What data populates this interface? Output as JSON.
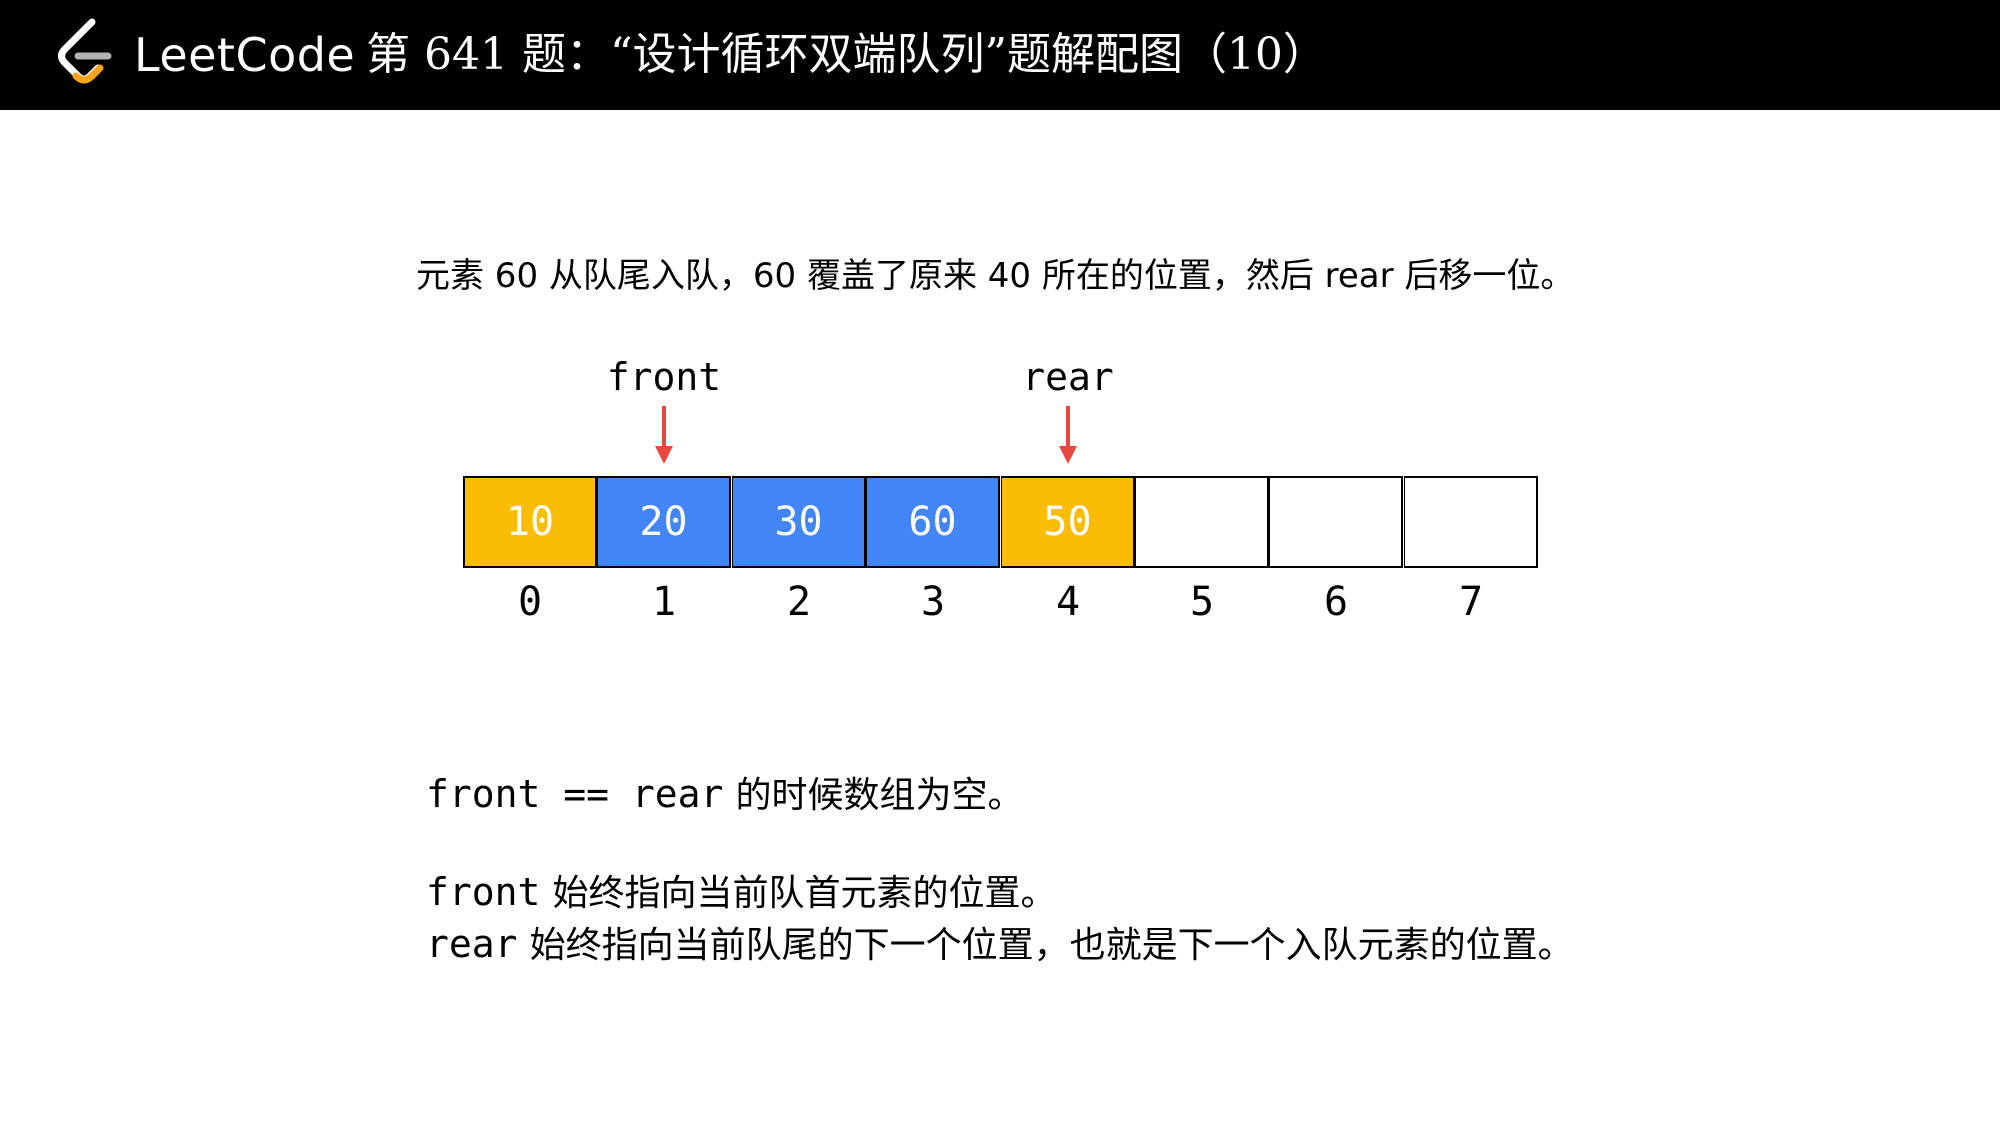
{
  "header": {
    "brand": "LeetCode",
    "title": "第 641 题：“设计循环双端队列”题解配图（10）"
  },
  "description": "元素 60 从队尾入队，60 覆盖了原来 40 所在的位置，然后 rear 后移一位。",
  "pointers": {
    "front": {
      "label": "front",
      "index": 1,
      "arrow_color": "#e9473f"
    },
    "rear": {
      "label": "rear",
      "index": 4,
      "arrow_color": "#e9473f"
    }
  },
  "queue": {
    "cells": [
      {
        "index": "0",
        "value": "10",
        "fill": "#fbbc05"
      },
      {
        "index": "1",
        "value": "20",
        "fill": "#4285f4"
      },
      {
        "index": "2",
        "value": "30",
        "fill": "#4285f4"
      },
      {
        "index": "3",
        "value": "60",
        "fill": "#4285f4"
      },
      {
        "index": "4",
        "value": "50",
        "fill": "#fbbc05"
      },
      {
        "index": "5",
        "value": "",
        "fill": "#ffffff"
      },
      {
        "index": "6",
        "value": "",
        "fill": "#ffffff"
      },
      {
        "index": "7",
        "value": "",
        "fill": "#ffffff"
      }
    ]
  },
  "notes": {
    "empty_rule": {
      "code": "front == rear",
      "text": "的时候数组为空。"
    },
    "front_rule": {
      "code": "front",
      "text": "始终指向当前队首元素的位置。"
    },
    "rear_rule": {
      "code": "rear",
      "text": "始终指向当前队尾的下一个位置，也就是下一个入队元素的位置。"
    }
  },
  "colors": {
    "header_bg": "#000000",
    "logo_orange": "#f8a31c",
    "highlight_yellow": "#fbbc05",
    "highlight_blue": "#4285f4",
    "arrow_red": "#e9473f"
  }
}
